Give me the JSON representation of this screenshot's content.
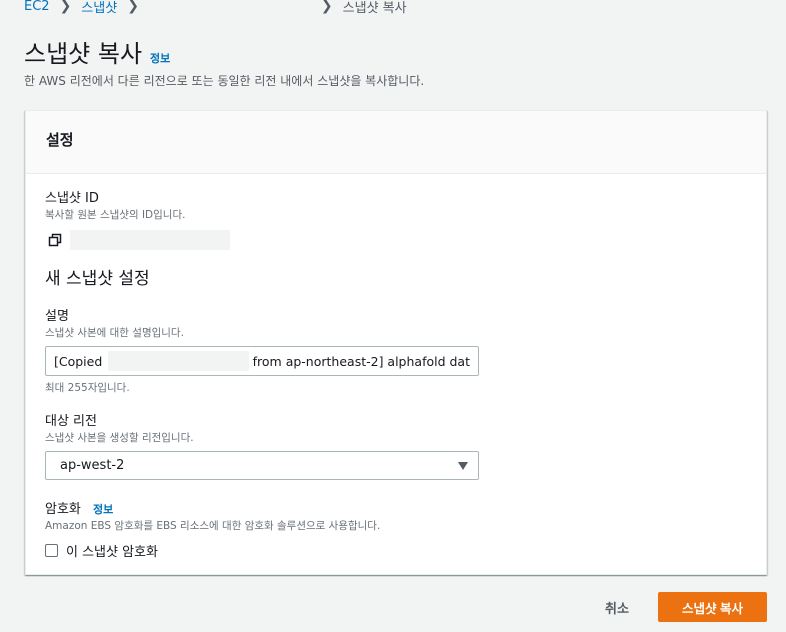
{
  "breadcrumb": {
    "items": [
      "EC2",
      "스냅샷"
    ],
    "current": "스냅샷 복사"
  },
  "page": {
    "title": "스냅샷 복사",
    "info_link": "정보",
    "description": "한 AWS 리전에서 다른 리전으로 또는 동일한 리전 내에서 스냅샷을 복사합니다."
  },
  "settings": {
    "header": "설정",
    "snapshot_id": {
      "label": "스냅샷 ID",
      "description": "복사할 원본 스냅샷의 ID입니다."
    },
    "new_snapshot_title": "새 스냅샷 설정",
    "description_field": {
      "label": "설명",
      "description": "스냅샷 사본에 대한 설명입니다.",
      "value_prefix": "[Copied",
      "value_suffix": "from ap-northeast-2] alphafold dat",
      "hint": "최대 255자입니다."
    },
    "region_field": {
      "label": "대상 리전",
      "description": "스냅샷 사본을 생성할 리전입니다.",
      "selected": "ap-west-2"
    },
    "encryption_field": {
      "label": "암호화",
      "info_link": "정보",
      "description": "Amazon EBS 암호화를 EBS 리소스에 대한 암호화 솔루션으로 사용합니다.",
      "checkbox_label": "이 스냅샷 암호화",
      "checked": false
    }
  },
  "actions": {
    "cancel": "취소",
    "submit": "스냅샷 복사"
  },
  "colors": {
    "link": "#0073bb",
    "primary_button": "#ec7211",
    "background": "#f2f3f3"
  }
}
